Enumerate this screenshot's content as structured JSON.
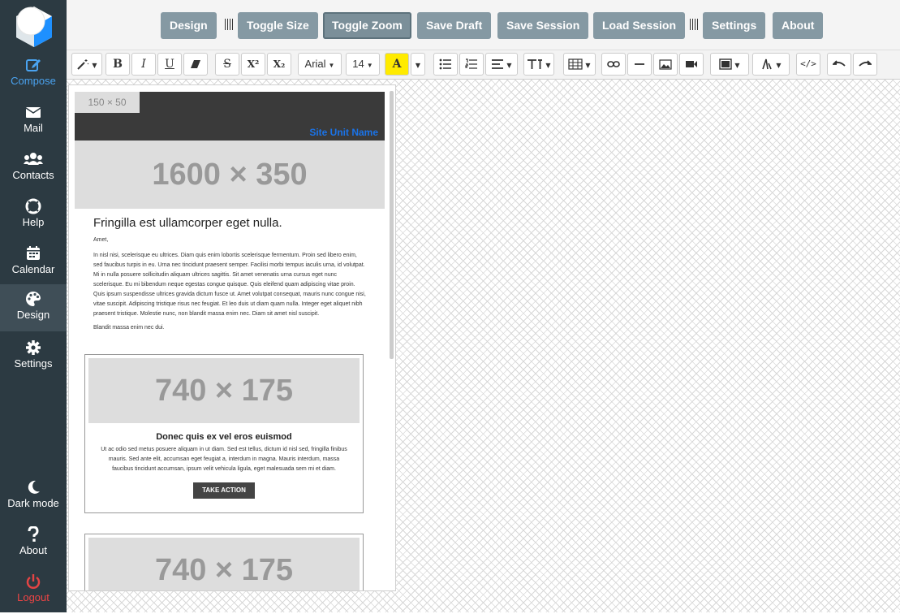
{
  "sidebar": {
    "items": [
      {
        "label": "Compose",
        "icon": "compose-icon"
      },
      {
        "label": "Mail",
        "icon": "mail-icon"
      },
      {
        "label": "Contacts",
        "icon": "contacts-icon"
      },
      {
        "label": "Help",
        "icon": "help-lifebuoy-icon"
      },
      {
        "label": "Calendar",
        "icon": "calendar-icon"
      },
      {
        "label": "Design",
        "icon": "palette-icon"
      },
      {
        "label": "Settings",
        "icon": "gear-icon"
      }
    ],
    "bottom": [
      {
        "label": "Dark mode",
        "icon": "moon-icon"
      },
      {
        "label": "About",
        "icon": "question-icon"
      },
      {
        "label": "Logout",
        "icon": "power-icon"
      }
    ]
  },
  "toolbar": {
    "design": "Design",
    "toggle_size": "Toggle Size",
    "toggle_zoom": "Toggle Zoom",
    "save_draft": "Save Draft",
    "save_session": "Save Session",
    "load_session": "Load Session",
    "settings": "Settings",
    "about": "About"
  },
  "editor": {
    "bold": "B",
    "italic": "I",
    "underline": "U",
    "strikethrough": "S",
    "superscript": "X²",
    "subscript": "X₂",
    "font_family": "Arial",
    "font_size": "14",
    "highlight": "A",
    "code_view": "</>"
  },
  "email": {
    "logo_placeholder": "150 × 50",
    "site_unit": "Site Unit Name",
    "hero_placeholder": "1600 × 350",
    "title": "Fringilla est ullamcorper eget nulla.",
    "salutation": "Amet,",
    "paragraph": "In nisl nisi, scelerisque eu ultrices. Diam quis enim lobortis scelerisque fermentum. Proin sed libero enim, sed faucibus turpis in eu. Urna nec tincidunt praesent semper. Facilisi morbi tempus iaculis urna, id volutpat. Mi in nulla posuere sollicitudin aliquam ultrices sagittis. Sit amet venenatis urna cursus eget nunc scelerisque. Eu mi bibendum neque egestas congue quisque. Quis eleifend quam adipiscing vitae proin. Quis ipsum suspendisse ultrices gravida dictum fusce ut. Amet volutpat consequat, mauris nunc congue nisi, vitae suscipit. Adipiscing tristique risus nec feugiat. Et leo duis ut diam quam nulla. Integer eget aliquet nibh praesent tristique. Molestie nunc, non blandit massa enim nec. Diam sit amet nisl suscipit.",
    "sign": "Blandit massa enim nec dui.",
    "card1": {
      "image": "740 × 175",
      "title": "Donec quis ex vel eros euismod",
      "text": "Ut ac odio sed metus posuere aliquam in ut diam. Sed est tellus, dictum id nisl sed, fringilla finibus mauris. Sed ante elit, accumsan eget feugiat a, interdum in magna. Mauris interdum, massa faucibus tincidunt accumsan, ipsum velit vehicula ligula, eget malesuada sem mi et diam.",
      "button": "TAKE ACTION"
    },
    "card2": {
      "image": "740 × 175"
    }
  },
  "colors": {
    "sidebar_bg": "#2c3a42",
    "accent": "#4aa3f0",
    "button_bg": "#8599a3",
    "logout": "#e44444",
    "link": "#1a73e8"
  }
}
